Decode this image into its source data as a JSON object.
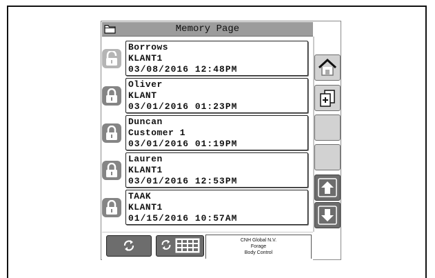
{
  "header": {
    "title": "Memory Page",
    "folder_icon": "folder-icon"
  },
  "entries": [
    {
      "name": "Borrows",
      "customer": "KLANT1",
      "datetime": "03/08/2016 12:48PM",
      "lock_icon": "unlocked-icon"
    },
    {
      "name": "Oliver",
      "customer": "KLANT",
      "datetime": "03/01/2016 01:23PM",
      "lock_icon": "locked-icon"
    },
    {
      "name": "Duncan",
      "customer": "Customer 1",
      "datetime": "03/01/2016 01:19PM",
      "lock_icon": "locked-icon"
    },
    {
      "name": "Lauren",
      "customer": "KLANT1",
      "datetime": "03/01/2016 12:53PM",
      "lock_icon": "locked-icon"
    },
    {
      "name": "TAAK",
      "customer": "KLANT1",
      "datetime": "01/15/2016 10:57AM",
      "lock_icon": "locked-icon"
    }
  ],
  "side_buttons": [
    {
      "icon": "home-icon"
    },
    {
      "icon": "copy-add-icon"
    },
    {
      "icon": "blank"
    },
    {
      "icon": "blank"
    },
    {
      "icon": "arrow-up-icon"
    },
    {
      "icon": "arrow-down-icon"
    }
  ],
  "bottom": {
    "refresh_icon": "refresh-icon",
    "refresh_grid_icon": "refresh-grid-icon",
    "brand_line1": "CNH Global N.V.",
    "brand_line2": "Forage",
    "brand_line3": "Body Control"
  },
  "colors": {
    "title_bar": "#9c9c9c",
    "button_dark": "#6d6d6d",
    "button_light": "#d2d2d2",
    "lock": "#858585"
  }
}
